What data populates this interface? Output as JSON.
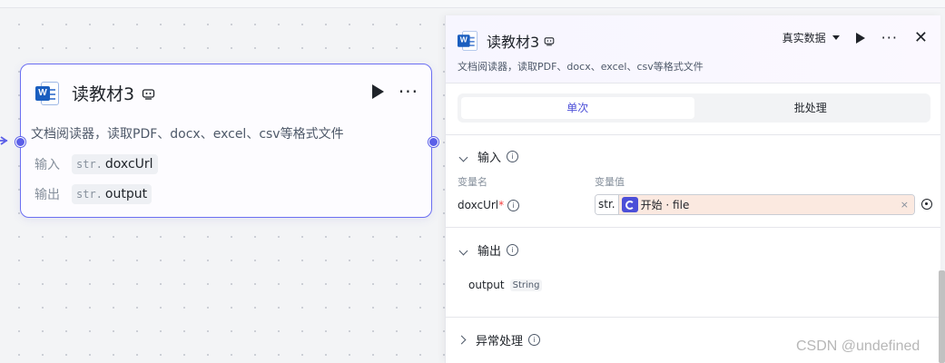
{
  "node": {
    "title": "读教材3",
    "description": "文档阅读器，读取PDF、docx、excel、csv等格式文件",
    "inputs_label": "输入",
    "outputs_label": "输出",
    "input": {
      "type": "str.",
      "name": "doxcUrl"
    },
    "output": {
      "type": "str.",
      "name": "output"
    }
  },
  "panel": {
    "title": "读教材3",
    "description": "文档阅读器，读取PDF、docx、excel、csv等格式文件",
    "data_select": "真实数据",
    "tabs": [
      {
        "label": "单次",
        "active": true
      },
      {
        "label": "批处理",
        "active": false
      }
    ],
    "input_section": {
      "title": "输入",
      "col_name": "变量名",
      "col_value": "变量值",
      "var_name": "doxcUrl",
      "required_mark": "*",
      "value_type": "str.",
      "value_ref": "开始 · file",
      "clear": "×"
    },
    "output_section": {
      "title": "输出",
      "var_name": "output",
      "var_type": "String"
    },
    "error_section": {
      "title": "异常处理"
    }
  },
  "watermark": "CSDN @undefined",
  "colors": {
    "accent": "#5b5fe8",
    "ref_bg": "#fbe9e0"
  }
}
